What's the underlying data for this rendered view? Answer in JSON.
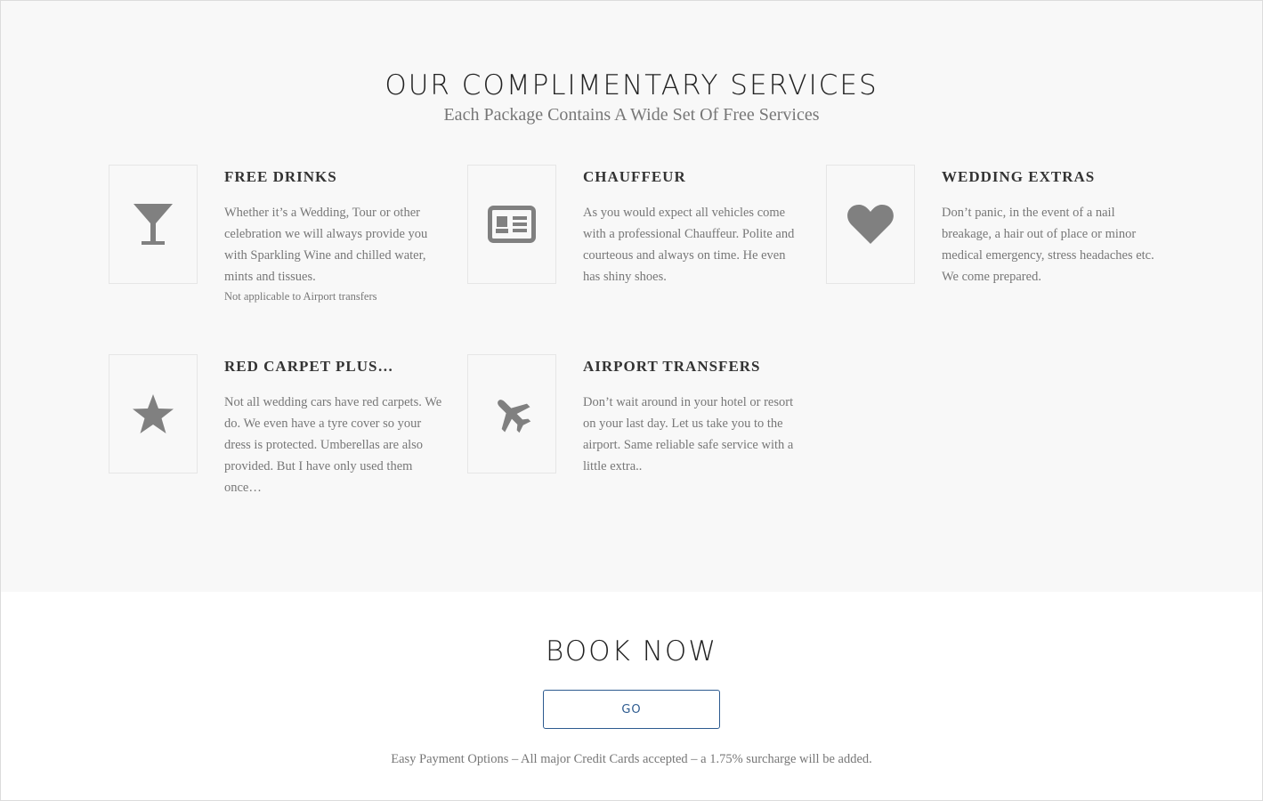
{
  "services": {
    "title": "OUR COMPLIMENTARY SERVICES",
    "subtitle": "Each Package Contains A Wide Set Of Free Services",
    "items": [
      {
        "icon": "cocktail-glass-icon",
        "title": "FREE DRINKS",
        "text": "Whether it’s a Wedding, Tour or other celebration we will always provide you with Sparkling Wine and chilled water, mints and tissues.",
        "note": "Not applicable to Airport transfers"
      },
      {
        "icon": "id-card-icon",
        "title": "CHAUFFEUR",
        "text": "As you would expect all vehicles come with a professional Chauffeur. Polite and courteous and always on time. He even has shiny shoes."
      },
      {
        "icon": "heart-icon",
        "title": "WEDDING EXTRAS",
        "text": "Don’t panic, in the event of a nail breakage, a hair out of place or minor medical emergency, stress headaches etc. We come prepared."
      },
      {
        "icon": "star-icon",
        "title": "RED CARPET PLUS…",
        "text": "Not all wedding cars have red carpets. We do. We even have a tyre cover so your dress is protected. Umberellas are also provided. But I have only used them once…"
      },
      {
        "icon": "airplane-icon",
        "title": "AIRPORT TRANSFERS",
        "text": "Don’t wait around in your hotel or resort on your last day. Let us take you to the airport. Same reliable safe service with a little extra.."
      }
    ]
  },
  "book": {
    "title": "BOOK NOW",
    "button_label": "GO",
    "payment_text": "Easy Payment Options – All major Credit Cards accepted – a 1.75% surcharge will be added."
  },
  "colors": {
    "icon": "#808080",
    "accent": "#2c5a8f",
    "section_bg": "#f8f8f8"
  }
}
